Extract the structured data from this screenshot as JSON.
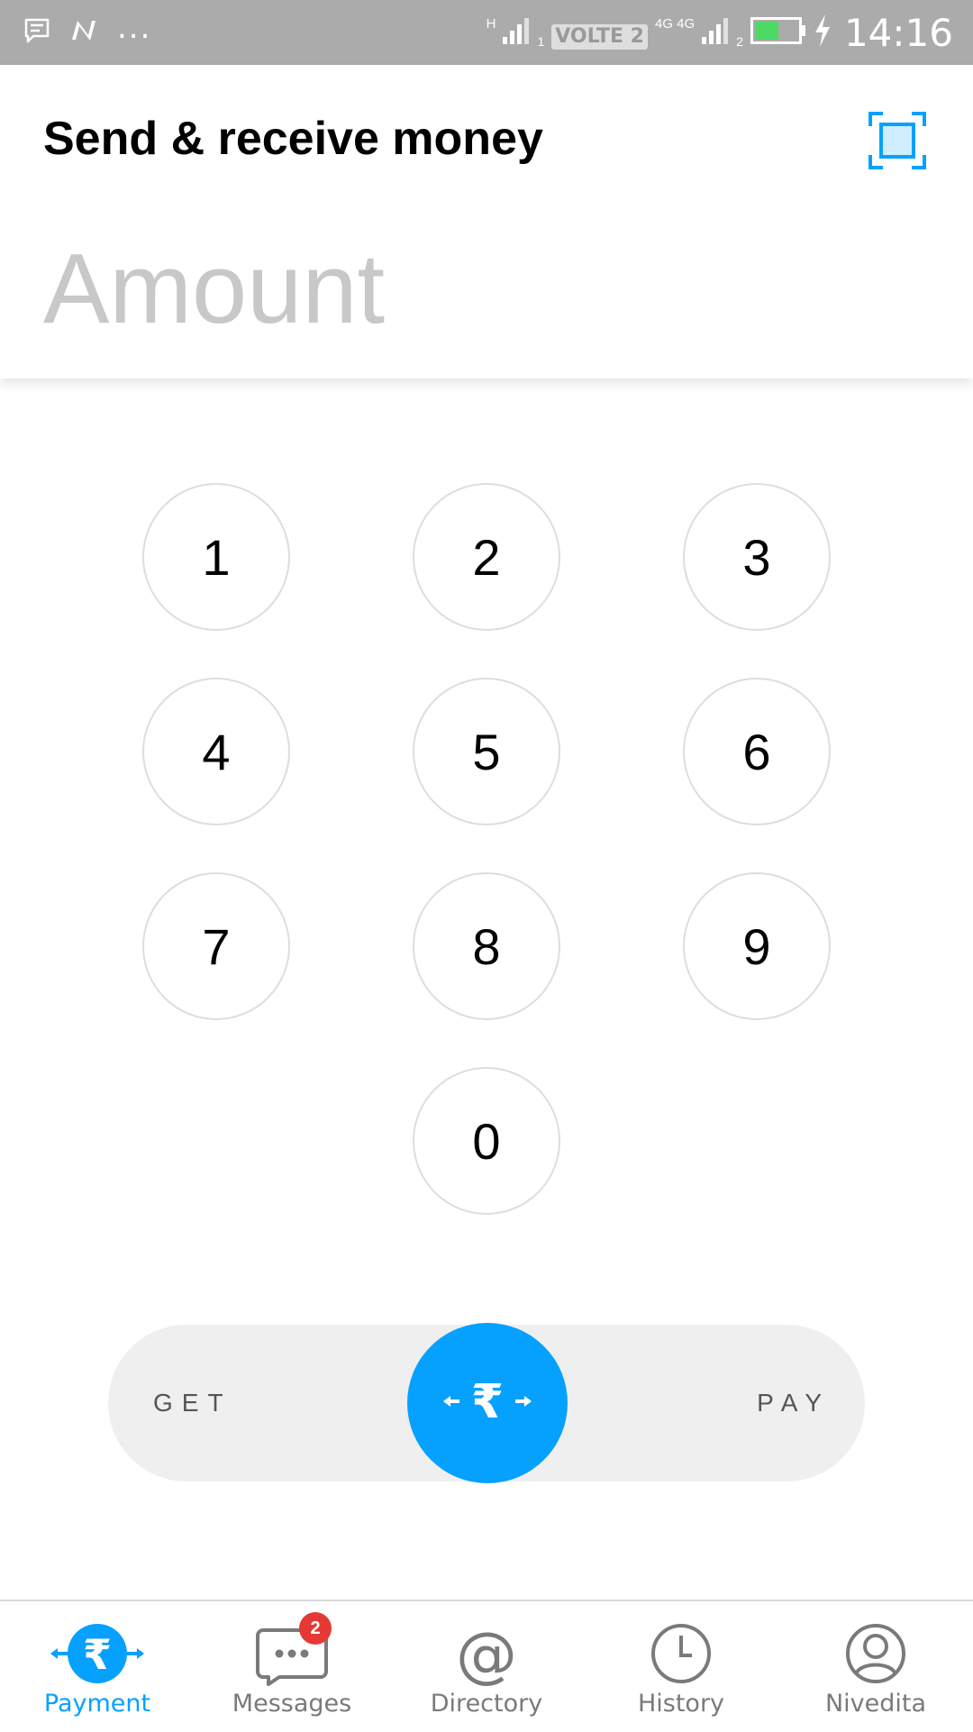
{
  "status_bar": {
    "time": "14:16",
    "more": "...",
    "network_type_1": "H",
    "sim_1": "1",
    "volte": "VOLTE 2",
    "network_type_2": "4G 4G",
    "sim_2": "2",
    "battery_level": 0.55,
    "icons": [
      "message-notification-icon",
      "n-app-icon",
      "signal-icon",
      "battery-icon",
      "charging-icon"
    ]
  },
  "header": {
    "title": "Send & receive money",
    "amount_placeholder": "Amount",
    "amount_value": "",
    "scan_icon": "qr-scan-icon"
  },
  "keypad": {
    "keys": [
      "1",
      "2",
      "3",
      "4",
      "5",
      "6",
      "7",
      "8",
      "9",
      "0"
    ]
  },
  "toggle": {
    "get_label": "GET",
    "pay_label": "PAY",
    "knob_icon": "rupee-arrows-icon"
  },
  "bottom_nav": {
    "items": [
      {
        "label": "Payment",
        "icon": "rupee-payment-icon",
        "active": true
      },
      {
        "label": "Messages",
        "icon": "chat-bubble-icon",
        "badge": "2"
      },
      {
        "label": "Directory",
        "icon": "at-sign-icon"
      },
      {
        "label": "History",
        "icon": "clock-icon"
      },
      {
        "label": "Nivedita",
        "icon": "profile-icon"
      }
    ]
  },
  "colors": {
    "accent": "#06a1ff",
    "status_bar": "#ababab",
    "badge": "#e53935",
    "placeholder": "#c8c8c8",
    "battery_fill": "#4cd964"
  }
}
